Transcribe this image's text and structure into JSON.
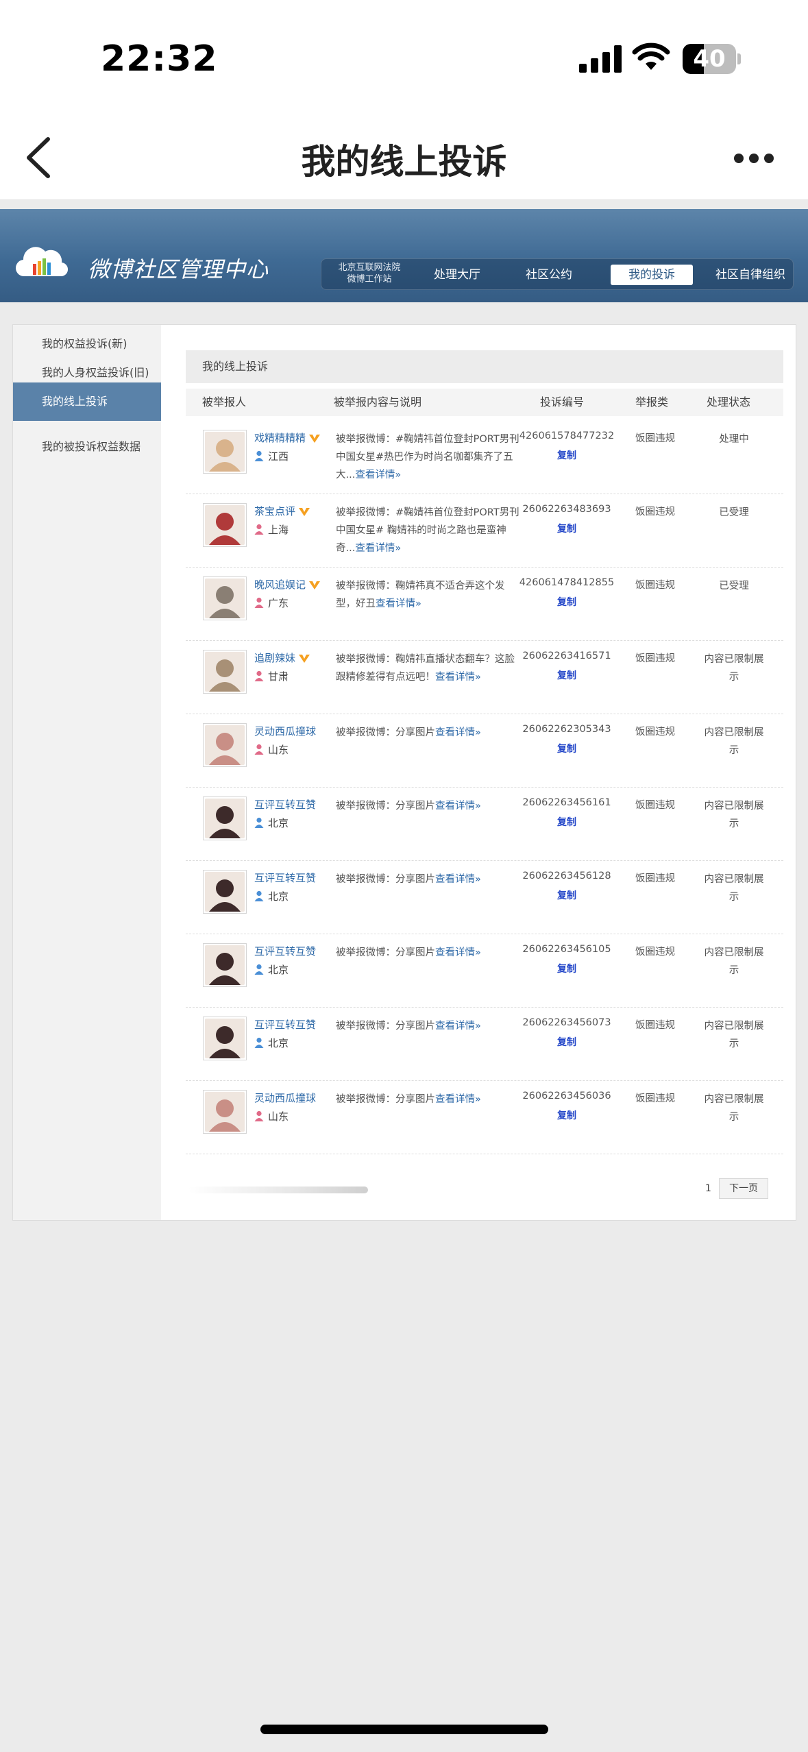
{
  "status_bar": {
    "time": "22:32",
    "battery": "40",
    "battery_level": 0.4
  },
  "navbar": {
    "title": "我的线上投诉"
  },
  "banner": {
    "logo_text": "微博社区管理中心",
    "court_line1": "北京互联网法院",
    "court_line2": "微博工作站",
    "nav_items": [
      "处理大厅",
      "社区公约",
      "我的投诉",
      "社区自律组织"
    ],
    "active_nav": "我的投诉"
  },
  "sidebar": {
    "items": [
      "我的权益投诉(新)",
      "我的人身权益投诉(旧)",
      "我的线上投诉",
      "我的被投诉权益数据"
    ],
    "active": "我的线上投诉"
  },
  "main": {
    "section_title": "我的线上投诉",
    "columns": [
      "被举报人",
      "被举报内容与说明",
      "投诉编号",
      "举报类",
      "处理状态"
    ],
    "copy_label": "复制",
    "rows": [
      {
        "name": "戏精精精精",
        "verified": true,
        "location": "江西",
        "gender": "male",
        "desc": "被举报微博：#鞠婧祎首位登封PORT男刊中国女星#热巴作为时尚名咖都集齐了五大...",
        "more": "查看详情»",
        "id": "426061578477232",
        "type": "饭圈违规",
        "status": "处理中",
        "avatar_color": "#d9b38c"
      },
      {
        "name": "茶宝点评",
        "verified": true,
        "location": "上海",
        "gender": "female",
        "desc": "被举报微博：#鞠婧祎首位登封PORT男刊中国女星# 鞠婧祎的时尚之路也是蛮神奇...",
        "more": "查看详情»",
        "id": "26062263483693",
        "type": "饭圈违规",
        "status": "已受理",
        "avatar_color": "#b03a3a"
      },
      {
        "name": "晚风追娱记",
        "verified": true,
        "location": "广东",
        "gender": "female",
        "desc": "被举报微博：鞠婧祎真不适合弄这个发型，好丑",
        "more": "查看详情»",
        "id": "426061478412855",
        "type": "饭圈违规",
        "status": "已受理",
        "avatar_color": "#8a7f74"
      },
      {
        "name": "追剧辣妹",
        "verified": true,
        "location": "甘肃",
        "gender": "female",
        "desc": "被举报微博：鞠婧祎直播状态翻车？这脸跟精修差得有点远吧！",
        "more": "查看详情»",
        "id": "26062263416571",
        "type": "饭圈违规",
        "status": "内容已限制展示",
        "avatar_color": "#a89076"
      },
      {
        "name": "灵动西瓜撞球",
        "verified": false,
        "location": "山东",
        "gender": "female",
        "desc": "被举报微博：分享图片",
        "more": "查看详情»",
        "id": "26062262305343",
        "type": "饭圈违规",
        "status": "内容已限制展示",
        "avatar_color": "#c98f86"
      },
      {
        "name": "互评互转互赞",
        "verified": false,
        "location": "北京",
        "gender": "male",
        "desc": "被举报微博：分享图片",
        "more": "查看详情»",
        "id": "26062263456161",
        "type": "饭圈违规",
        "status": "内容已限制展示",
        "avatar_color": "#3d2a2a"
      },
      {
        "name": "互评互转互赞",
        "verified": false,
        "location": "北京",
        "gender": "male",
        "desc": "被举报微博：分享图片",
        "more": "查看详情»",
        "id": "26062263456128",
        "type": "饭圈违规",
        "status": "内容已限制展示",
        "avatar_color": "#3d2a2a"
      },
      {
        "name": "互评互转互赞",
        "verified": false,
        "location": "北京",
        "gender": "male",
        "desc": "被举报微博：分享图片",
        "more": "查看详情»",
        "id": "26062263456105",
        "type": "饭圈违规",
        "status": "内容已限制展示",
        "avatar_color": "#3d2a2a"
      },
      {
        "name": "互评互转互赞",
        "verified": false,
        "location": "北京",
        "gender": "male",
        "desc": "被举报微博：分享图片",
        "more": "查看详情»",
        "id": "26062263456073",
        "type": "饭圈违规",
        "status": "内容已限制展示",
        "avatar_color": "#3d2a2a"
      },
      {
        "name": "灵动西瓜撞球",
        "verified": false,
        "location": "山东",
        "gender": "female",
        "desc": "被举报微博：分享图片",
        "more": "查看详情»",
        "id": "26062263456036",
        "type": "饭圈违规",
        "status": "内容已限制展示",
        "avatar_color": "#c98f86"
      }
    ]
  },
  "pager": {
    "current_page": "1",
    "next_label": "下一页"
  }
}
